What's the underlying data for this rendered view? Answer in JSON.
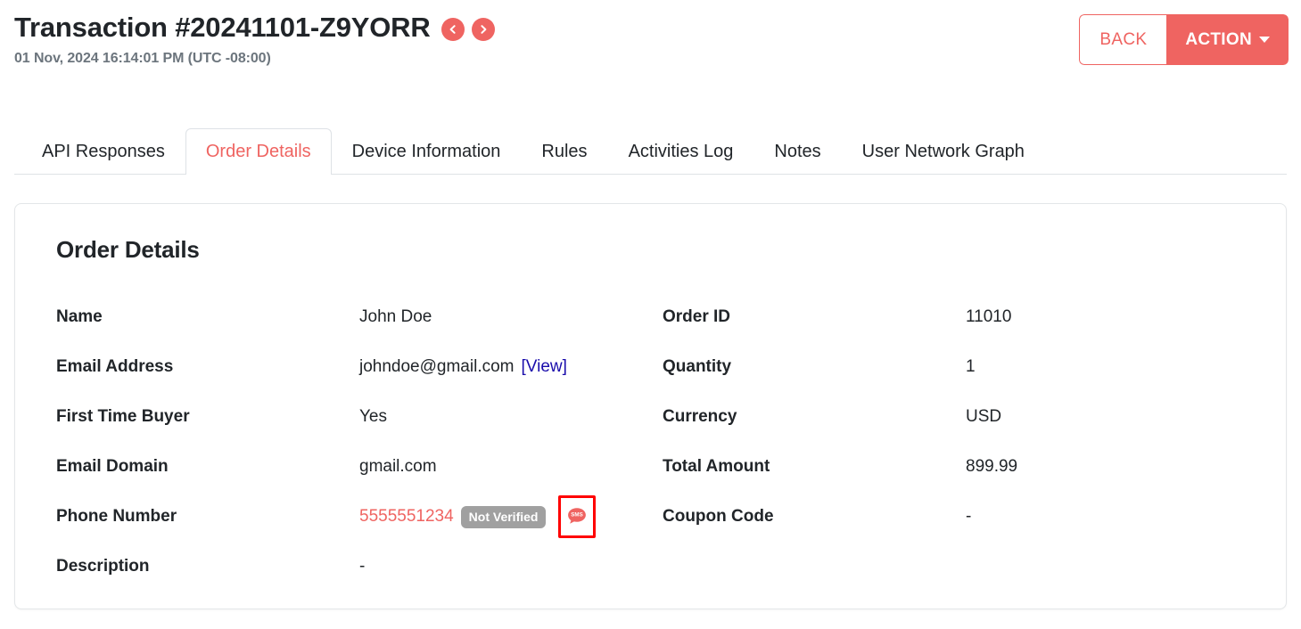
{
  "header": {
    "title": "Transaction #20241101-Z9YORR",
    "timestamp": "01 Nov, 2024 16:14:01 PM (UTC -08:00)",
    "prev_icon": "chevron-left-icon",
    "next_icon": "chevron-right-icon",
    "back_label": "BACK",
    "action_label": "ACTION"
  },
  "tabs": [
    {
      "label": "API Responses",
      "active": false
    },
    {
      "label": "Order Details",
      "active": true
    },
    {
      "label": "Device Information",
      "active": false
    },
    {
      "label": "Rules",
      "active": false
    },
    {
      "label": "Activities Log",
      "active": false
    },
    {
      "label": "Notes",
      "active": false
    },
    {
      "label": "User Network Graph",
      "active": false
    }
  ],
  "card": {
    "title": "Order Details",
    "left": [
      {
        "label": "Name",
        "value": "John Doe"
      },
      {
        "label": "Email Address",
        "value": "johndoe@gmail.com",
        "link": "[View]"
      },
      {
        "label": "First Time Buyer",
        "value": "Yes"
      },
      {
        "label": "Email Domain",
        "value": "gmail.com"
      },
      {
        "label": "Phone Number",
        "value": "5555551234",
        "badge": "Not Verified",
        "icon": "sms-icon"
      },
      {
        "label": "Description",
        "value": "-"
      }
    ],
    "right": [
      {
        "label": "Order ID",
        "value": "11010"
      },
      {
        "label": "Quantity",
        "value": "1"
      },
      {
        "label": "Currency",
        "value": "USD"
      },
      {
        "label": "Total Amount",
        "value": "899.99"
      },
      {
        "label": "Coupon Code",
        "value": "-"
      }
    ]
  },
  "colors": {
    "accent": "#ef6461",
    "link": "#1a0dab",
    "badge_grey": "#a0a0a0",
    "highlight": "#ff0000",
    "muted": "#6c757d"
  }
}
